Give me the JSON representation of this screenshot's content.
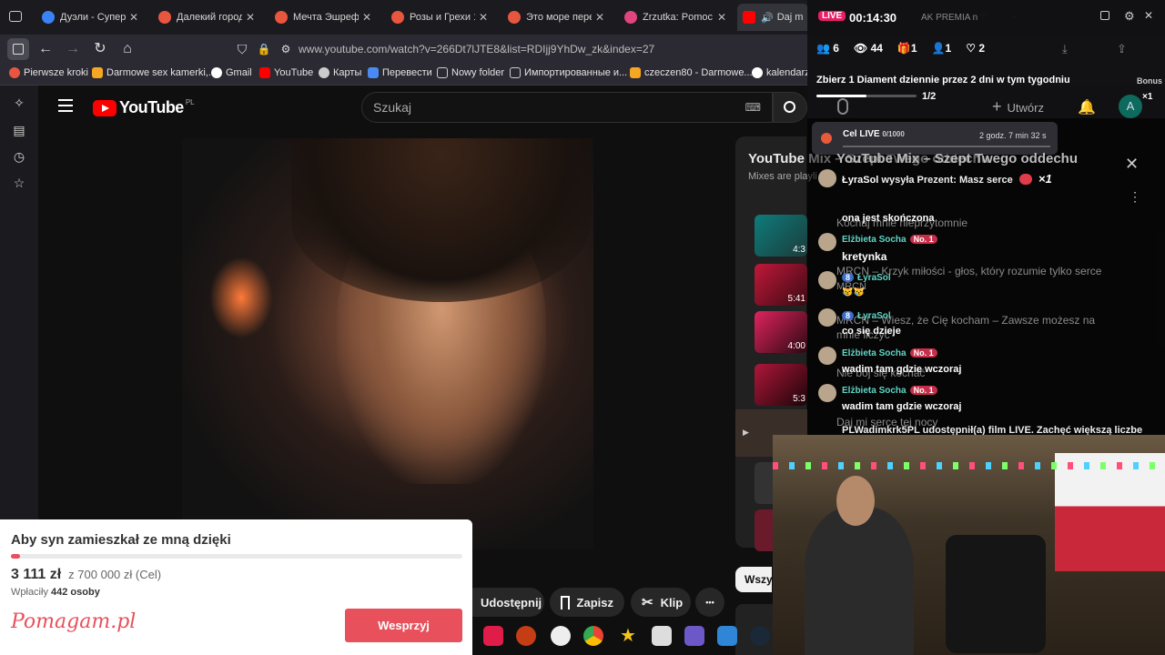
{
  "tabs": [
    {
      "label": "Дуэли - Суперзвезда",
      "color": "#3b82f6"
    },
    {
      "label": "Далекий город 45",
      "color": "#e8563f"
    },
    {
      "label": "Мечта Эшрефа 28",
      "color": "#e8563f"
    },
    {
      "label": "Розы и Грехи 12 с",
      "color": "#e8563f"
    },
    {
      "label": "Это море переполо",
      "color": "#e8563f"
    },
    {
      "label": "Zrzutka: Pomoc ko",
      "color": "#e0457b"
    },
    {
      "label": "Daj mi ser",
      "color": "#ff0000"
    }
  ],
  "address": {
    "url": "www.youtube.com/watch?v=266Dt7lJTE8&list=RDIjj9YhDw_zk&index=27"
  },
  "bookmarks": [
    "Pierwsze kroki",
    "Darmowe sex kamerki,...",
    "Gmail",
    "YouTube",
    "Карты",
    "Перевести",
    "Nowy folder",
    "Импортированные и...",
    "czeczen80 - Darmowe...",
    "kalendarz"
  ],
  "youtube": {
    "logo": "YouTube",
    "region": "PL",
    "search_placeholder": "Szukaj",
    "create_label": "Utwórz",
    "avatar": "A",
    "panel_title": "YouTube Mix – Szept Twego oddechu",
    "panel_sub": "Mixes are playli",
    "durations": [
      "4:3",
      "5:41",
      "4:00",
      "5:3"
    ],
    "playlist_ghost": [
      "Kochaj mnie nieprzytomnie",
      "MRCN – Krzyk miłości - głos, który rozumie tylko serce",
      "MRCN",
      "MRCN – Wiesz, że Cię kocham – Zawsze możesz na",
      "mnie liczyć",
      "Nie bój się kochać",
      "Daj mi serce tej nocy"
    ],
    "actions": {
      "share": "Udostępnij",
      "save": "Zapisz",
      "clip": "Klip",
      "more": "•••"
    },
    "chip": "Wszys"
  },
  "donation": {
    "title": "Aby syn zamieszkał ze mną dzięki",
    "amount": "3 111 zł",
    "goal": "z 700 000 zł (Cel)",
    "payers_label": "Wpłaciły",
    "payers_count": "442 osoby",
    "logo": "Pomagam.pl",
    "button": "Wesprzyj",
    "progress": 0.0044
  },
  "stream": {
    "live": "LIVE",
    "timer": "00:14:30",
    "premia": "AK PREMIA n",
    "stats": {
      "followers": "6",
      "viewers": "44",
      "gifts": "1",
      "joins": "1",
      "likes": "2"
    },
    "task": "Zbierz 1 Diament dziennie przez 2 dni w tym tygodniu",
    "task_progress": "1/2",
    "bonus": "Bonus",
    "bonus_x": "×1",
    "goal_label": "Cel LIVE",
    "goal_value": "0/1000",
    "goal_time": "2 godz. 7 min 32 s",
    "gift_line": {
      "user": "ŁyraSol",
      "text": "wysyła Prezent: Masz serce",
      "mult": "×1"
    },
    "messages": [
      {
        "name": "",
        "text": "ona jest skończona"
      },
      {
        "name": "Elżbieta Socha",
        "badge": "No. 1",
        "text": "kretynka"
      },
      {
        "name": "ŁyraSol",
        "level": "8",
        "text": "😿😿"
      },
      {
        "name": "ŁyraSol",
        "level": "8",
        "text": "co się dzieje"
      },
      {
        "name": "Elżbieta Socha",
        "badge": "No. 1",
        "text": "wadim tam gdzie wczoraj"
      },
      {
        "name": "Elżbieta Socha",
        "badge": "No. 1",
        "text": "wadim tam gdzie wczoraj"
      }
    ],
    "share_line": "PLWadimkrk5PL udostępnił(a) film LIVE. Zachęć większą liczbe"
  }
}
